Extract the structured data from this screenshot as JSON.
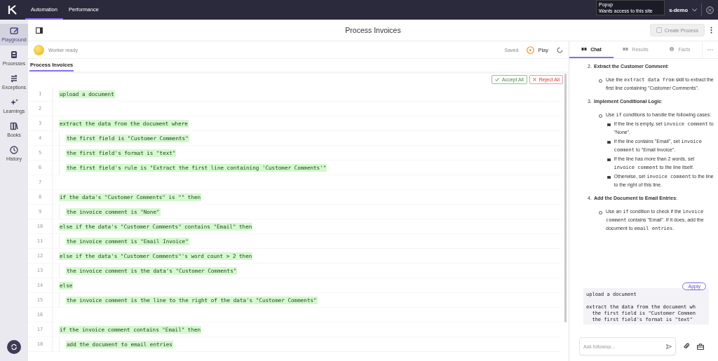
{
  "top_bar": {
    "nav_tabs": [
      {
        "label": "Automation",
        "selected": true
      },
      {
        "label": "Performance",
        "selected": false
      }
    ],
    "popup": {
      "title": "Popup",
      "message": "Wants access to this site"
    },
    "account": "s-demo"
  },
  "sidebar": {
    "items": [
      {
        "label": "Playground",
        "selected": true,
        "kind": "playground"
      },
      {
        "label": "Processes",
        "selected": false,
        "kind": "processes"
      },
      {
        "label": "Exceptions",
        "selected": false,
        "kind": "exceptions"
      },
      {
        "label": "Learnings",
        "selected": false,
        "kind": "learnings"
      },
      {
        "label": "Books",
        "selected": false,
        "kind": "books"
      },
      {
        "label": "History",
        "selected": false,
        "kind": "history"
      }
    ]
  },
  "header": {
    "title": "Process Invoices",
    "create_button": {
      "label": "Create Process",
      "disabled": true
    }
  },
  "editor": {
    "worker_status": "Worker ready",
    "save_status": "Saved",
    "play_label": "Play",
    "tabs": [
      {
        "label": "Process Invoices",
        "selected": true
      }
    ],
    "actions": [
      {
        "label": "Accept All",
        "kind": "accept"
      },
      {
        "label": "Reject All",
        "kind": "reject"
      }
    ],
    "lines": [
      {
        "number": "1",
        "text": "upload a document",
        "added": true
      },
      {
        "number": "2"
      },
      {
        "number": "3",
        "text": "extract the data from the document where",
        "added": true,
        "children": [
          {
            "number": "4",
            "text": "the first field is \"Customer Comments\"",
            "added": true
          },
          {
            "number": "5",
            "text": "the first field's format is \"text\"",
            "added": true
          },
          {
            "number": "6",
            "text": "the first field's rule is \"Extract the first line containing 'Customer Comments'\"",
            "added": true
          }
        ]
      },
      {
        "number": "7"
      },
      {
        "number": "8",
        "text": "if the data's \"Customer Comments\" is \"\" then",
        "added": true,
        "children": [
          {
            "number": "9",
            "text": "the invoice comment is \"None\"",
            "added": true
          }
        ]
      },
      {
        "number": "10",
        "text": "else if the data's \"Customer Comments\" contains \"Email\" then",
        "added": true,
        "children": [
          {
            "number": "11",
            "text": "the invoice comment is \"Email Invoice\"",
            "added": true
          }
        ]
      },
      {
        "number": "12",
        "text": "else if the data's \"Customer Comments\"'s word count > 2 then",
        "added": true,
        "children": [
          {
            "number": "13",
            "text": "the invoice comment is the data's \"Customer Comments\"",
            "added": true
          }
        ]
      },
      {
        "number": "14",
        "text": "else",
        "added": true,
        "children": [
          {
            "number": "15",
            "text": "the invoice comment is the line to the right of the data's \"Customer Comments\"",
            "added": true
          }
        ]
      },
      {
        "number": "16"
      },
      {
        "number": "17",
        "text": "if the invoice comment contains \"Email\" then",
        "added": true,
        "children": [
          {
            "number": "18",
            "text": "add the document to email entries",
            "added": true
          }
        ]
      }
    ]
  },
  "chat": {
    "tabs": [
      {
        "label": "Chat",
        "selected": true,
        "kind": "chat"
      },
      {
        "label": "Results",
        "selected": false,
        "kind": "results"
      },
      {
        "label": "Facts",
        "selected": false,
        "kind": "facts"
      }
    ],
    "steps": [
      {
        "number": "2.",
        "title": "**Extract the Customer Comment**:",
        "bullets": [
          {
            "parts": [
              {
                "kind": "text",
                "text": "Use the "
              },
              {
                "kind": "code",
                "text": "extract data from"
              },
              {
                "kind": "text",
                "text": " skill to extract the first line containing \"Customer Comments\"."
              }
            ]
          }
        ]
      },
      {
        "number": "3.",
        "title": "**Implement Conditional Logic**:",
        "bullets": [
          {
            "parts": [
              {
                "kind": "text",
                "text": "Use "
              },
              {
                "kind": "code",
                "text": "if"
              },
              {
                "kind": "text",
                "text": " conditions to handle the following cases:"
              }
            ],
            "children": [
              {
                "parts": [
                  {
                    "kind": "text",
                    "text": "If the line is empty, set "
                  },
                  {
                    "kind": "code",
                    "text": "invoice comment"
                  },
                  {
                    "kind": "text",
                    "text": " to \"None\"."
                  }
                ]
              },
              {
                "parts": [
                  {
                    "kind": "text",
                    "text": "If the line contains \"Email\", set "
                  },
                  {
                    "kind": "code",
                    "text": "invoice comment"
                  },
                  {
                    "kind": "text",
                    "text": " to \"Email Invoice\"."
                  }
                ]
              },
              {
                "parts": [
                  {
                    "kind": "text",
                    "text": "If the line has more than 2 words, set "
                  },
                  {
                    "kind": "code",
                    "text": "invoice comment"
                  },
                  {
                    "kind": "text",
                    "text": " to the line itself."
                  }
                ]
              },
              {
                "parts": [
                  {
                    "kind": "text",
                    "text": "Otherwise, set "
                  },
                  {
                    "kind": "code",
                    "text": "invoice comment"
                  },
                  {
                    "kind": "text",
                    "text": " to the line to the right of this line."
                  }
                ]
              }
            ]
          }
        ]
      },
      {
        "number": "4.",
        "title": "**Add the Document to Email Entries**:",
        "bullets": [
          {
            "parts": [
              {
                "kind": "text",
                "text": "Use an "
              },
              {
                "kind": "code",
                "text": "if"
              },
              {
                "kind": "text",
                "text": " condition to check if the "
              },
              {
                "kind": "code",
                "text": "invoice comment"
              },
              {
                "kind": "text",
                "text": " contains \"Email\". If it does, add the document to "
              },
              {
                "kind": "code",
                "text": "email entries"
              },
              {
                "kind": "text",
                "text": "."
              }
            ]
          }
        ]
      }
    ],
    "code_block": {
      "apply_label": "Apply",
      "blocks": [
        {
          "lines": [
            "upload a document"
          ]
        },
        {
          "lines": [
            "extract the data from the document wh",
            "  the first field is \"Customer Commen",
            "  the first field's format is \"text\""
          ]
        }
      ]
    },
    "input": {
      "placeholder": "Ask followup..."
    }
  }
}
